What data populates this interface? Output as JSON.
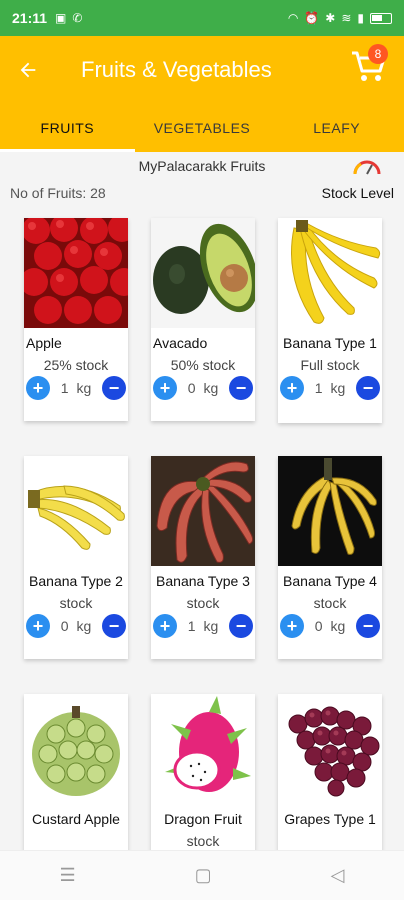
{
  "status": {
    "time": "21:11"
  },
  "appbar": {
    "title": "Fruits & Vegetables",
    "cart_count": "8"
  },
  "tabs": [
    "FRUITS",
    "VEGETABLES",
    "LEAFY"
  ],
  "header": {
    "brand": "MyPalacarakk Fruits",
    "count": "No of Fruits: 28",
    "stock_level": "Stock Level"
  },
  "fruits": [
    {
      "name": "Apple",
      "stock": "25% stock",
      "qty": "1",
      "unit": "kg"
    },
    {
      "name": "Avacado",
      "stock": "50% stock",
      "qty": "0",
      "unit": "kg"
    },
    {
      "name": "Banana Type 1",
      "stock": "Full  stock",
      "qty": "1",
      "unit": "kg"
    },
    {
      "name": "Banana Type 2",
      "stock": "stock",
      "qty": "0",
      "unit": "kg"
    },
    {
      "name": "Banana Type 3",
      "stock": "stock",
      "qty": "1",
      "unit": "kg"
    },
    {
      "name": "Banana Type 4",
      "stock": "stock",
      "qty": "0",
      "unit": "kg"
    },
    {
      "name": "Custard Apple",
      "stock": "",
      "qty": "",
      "unit": ""
    },
    {
      "name": "Dragon Fruit",
      "stock": "stock",
      "qty": "",
      "unit": ""
    },
    {
      "name": "Grapes Type 1",
      "stock": "",
      "qty": "",
      "unit": ""
    }
  ],
  "colors": {
    "accent": "#ffbf00",
    "status": "#3fae49",
    "plus": "#2b8ff0",
    "minus": "#1b49e0",
    "badge": "#ff5722"
  }
}
